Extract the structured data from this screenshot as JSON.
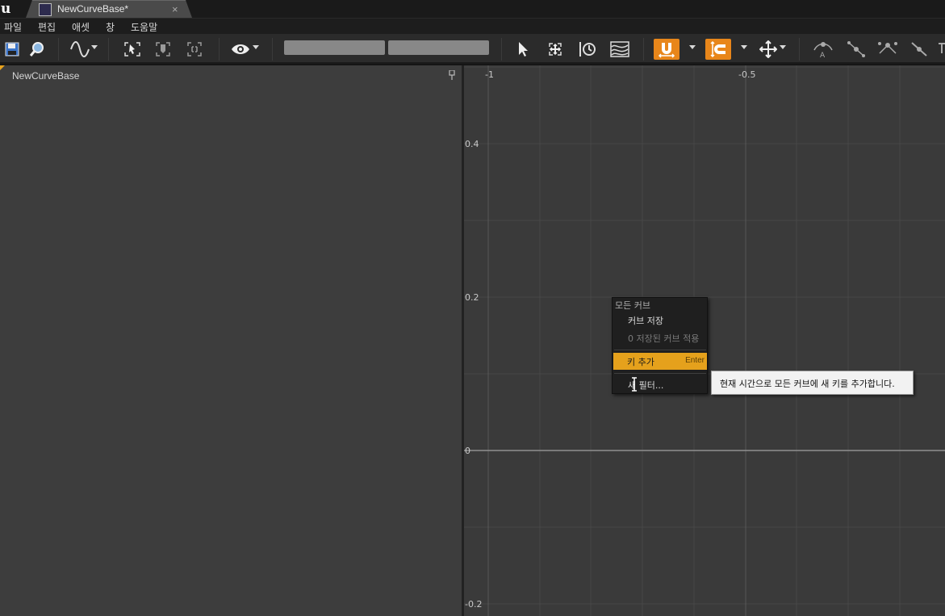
{
  "app": {
    "logo": "u",
    "logo_icon": "unreal-logo-icon"
  },
  "tab": {
    "title": "NewCurveBase*",
    "close": "×"
  },
  "menu": {
    "items": [
      "파일",
      "편집",
      "애셋",
      "창",
      "도움말"
    ]
  },
  "toolbar": {
    "icons": [
      "save-icon",
      "find-in-browser-icon",
      "curve-display-icon",
      "zoom-to-fit-horizontal-icon",
      "zoom-to-fit-vertical-icon",
      "zoom-to-fit-icon",
      "visibility-icon",
      "select-icon",
      "frame-icon",
      "time-snap-icon",
      "curve-view-icon",
      "value-snap-icon",
      "vertical-snap-icon",
      "move-icon",
      "auto-tangent-icon",
      "user-tangent-icon",
      "break-tangent-icon",
      "linear-tangent-icon",
      "constant-tangent-icon"
    ],
    "accent": "#e8861a"
  },
  "left_panel": {
    "curve_name": "NewCurveBase"
  },
  "graph": {
    "x_labels": [
      "-1",
      "-0.5"
    ],
    "y_labels": [
      "0.4",
      "0.2",
      "0",
      "-0.2"
    ]
  },
  "context_menu": {
    "header": "모든 커브",
    "save_curve": "커브 저장",
    "apply_saved": "0 저장된 커브 적용",
    "add_key": "키 추가",
    "add_key_shortcut": "Enter",
    "filter": "새 필터..."
  },
  "tooltip": {
    "text": "현재 시간으로 모든 커브에 새 키를 추가합니다."
  }
}
